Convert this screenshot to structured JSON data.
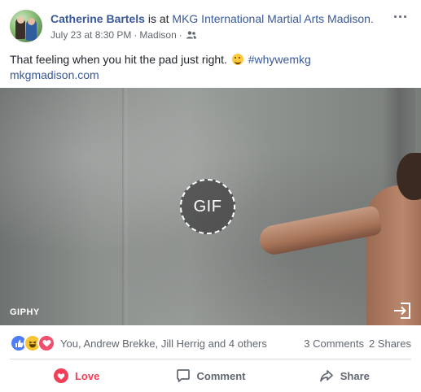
{
  "post": {
    "author": "Catherine Bartels",
    "at_text": " is at ",
    "place": "MKG International Martial Arts Madison.",
    "date": "July 23 at 8:30 PM",
    "separator": " · ",
    "location": "Madison",
    "privacy_icon": "friends-icon",
    "text": "That feeling when you hit the pad just right.",
    "emoji": "winking-face",
    "hashtag": "#whywemkg",
    "link": "mkgmadison.com"
  },
  "media": {
    "badge": "GIF",
    "provider": "GIPHY",
    "open_icon": "open-external-icon"
  },
  "reactions": {
    "icons": [
      "like",
      "haha",
      "love"
    ],
    "names": "You, Andrew Brekke, Jill Herrig and 4 others",
    "comments": "3 Comments",
    "shares": "2 Shares"
  },
  "actions": {
    "love_label": "Love",
    "comment_label": "Comment",
    "share_label": "Share"
  },
  "colors": {
    "link": "#385898",
    "love": "#f33e58",
    "like": "#4f7cf7",
    "haha": "#f7c533"
  }
}
